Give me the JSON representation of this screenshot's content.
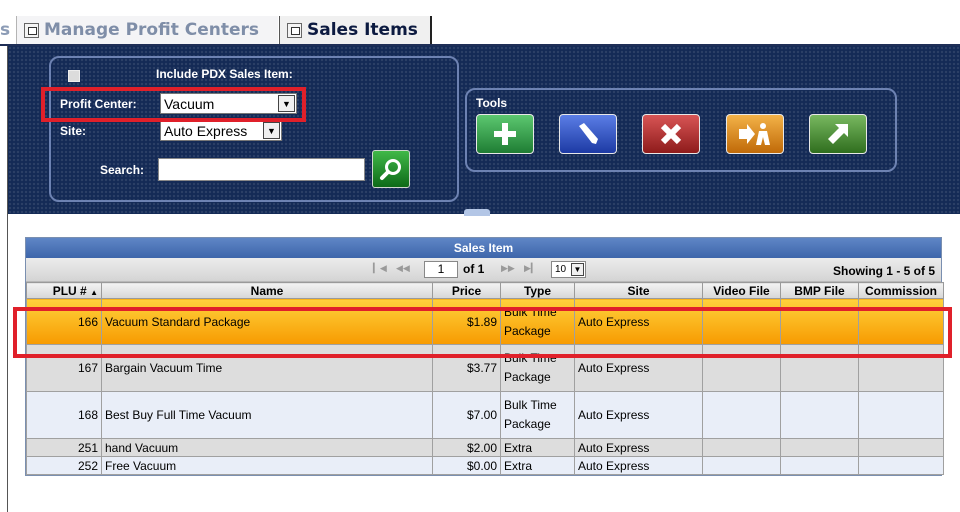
{
  "tabs": [
    {
      "label": "s"
    },
    {
      "label": "Manage Profit Centers"
    },
    {
      "label": "Sales Items"
    }
  ],
  "filters": {
    "include_pdx_label": "Include PDX Sales Item:",
    "profit_center_label": "Profit Center:",
    "profit_center_value": "Vacuum",
    "site_label": "Site:",
    "site_value": "Auto Express",
    "search_label": "Search:",
    "search_value": ""
  },
  "tools": {
    "label": "Tools",
    "buttons": [
      {
        "icon": "plus-icon",
        "color": "#2c9c44"
      },
      {
        "icon": "pencil-icon",
        "color": "#2b4fc0"
      },
      {
        "icon": "delete-x-icon",
        "color": "#b52a2a"
      },
      {
        "icon": "transfer-icon",
        "color": "#e08a12"
      },
      {
        "icon": "arrow-up-right-icon",
        "color": "#3e8a2a"
      }
    ]
  },
  "grid": {
    "title": "Sales Item",
    "pager": {
      "page": "1",
      "of": "of 1",
      "page_size": "10",
      "showing": "Showing 1 - 5 of 5"
    },
    "columns": [
      "PLU #",
      "Name",
      "Price",
      "Type",
      "Site",
      "Video File",
      "BMP File",
      "Commission"
    ],
    "rows": [
      {
        "plu": "166",
        "name": "Vacuum Standard Package",
        "price": "$1.89",
        "type_line1": "Bulk Time",
        "type_line2": "Package",
        "site": "Auto Express",
        "video": "",
        "bmp": "",
        "commission": ""
      },
      {
        "plu": "167",
        "name": "Bargain Vacuum Time",
        "price": "$3.77",
        "type_line1": "Bulk Time",
        "type_line2": "Package",
        "site": "Auto Express",
        "video": "",
        "bmp": "",
        "commission": ""
      },
      {
        "plu": "168",
        "name": "Best Buy Full Time Vacuum",
        "price": "$7.00",
        "type_line1": "Bulk Time",
        "type_line2": "Package",
        "site": "Auto Express",
        "video": "",
        "bmp": "",
        "commission": ""
      },
      {
        "plu": "251",
        "name": "hand Vacuum",
        "price": "$2.00",
        "type_line1": "Extra",
        "type_line2": "",
        "site": "Auto Express",
        "video": "",
        "bmp": "",
        "commission": ""
      },
      {
        "plu": "252",
        "name": "Free Vacuum",
        "price": "$0.00",
        "type_line1": "Extra",
        "type_line2": "",
        "site": "Auto Express",
        "video": "",
        "bmp": "",
        "commission": ""
      }
    ]
  },
  "colors": {
    "panel_bg": "#142a56",
    "highlight_red": "#e0202a",
    "selected_row": "#f7a800"
  }
}
